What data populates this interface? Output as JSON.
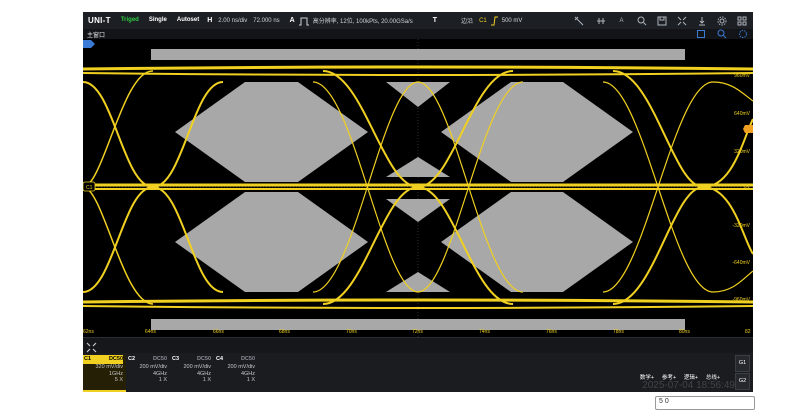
{
  "topbar": {
    "logo": "UNI-T",
    "trig_status": "Triged",
    "single_label": "Single",
    "autoset_label": "Autoset",
    "h_label": "H",
    "timebase": "2.00 ns/div",
    "h_delay": "72.000 ns",
    "a_label": "A",
    "acq_info": "高分辨率, 12位, 100kPts, 20.00GSa/s",
    "t_label": "T",
    "trig_mode": "边沿",
    "trig_src": "C1",
    "trig_level": "500 mV"
  },
  "subbar": {
    "title": "主窗口"
  },
  "scope": {
    "y_labels": [
      "960mV",
      "640mV",
      "320mV",
      "0V",
      "-320mV",
      "-640mV",
      "-960mV"
    ],
    "x_labels": [
      "62ns",
      "64ns",
      "66ns",
      "68ns",
      "70ns",
      "72ns",
      "74ns",
      "76ns",
      "78ns",
      "80ns",
      "82"
    ],
    "trace_color": "#f0d020",
    "mask_color": "#a8a8a8",
    "ch1_marker": "C1"
  },
  "channels": [
    {
      "name": "C1",
      "coupling": "DC50",
      "scale": "320 mV/div",
      "bw": "1GHz",
      "probe": "5 X"
    },
    {
      "name": "C2",
      "coupling": "DC50",
      "scale": "200 mV/div",
      "bw": "4GHz",
      "probe": "1 X"
    },
    {
      "name": "C3",
      "coupling": "DC50",
      "scale": "200 mV/div",
      "bw": "4GHz",
      "probe": "1 X"
    },
    {
      "name": "C4",
      "coupling": "DC50",
      "scale": "200 mV/div",
      "bw": "4GHz",
      "probe": "1 X"
    }
  ],
  "right_buttons": [
    "数学+",
    "参考+",
    "逻辑+",
    "总线+"
  ],
  "g_buttons": [
    "G1",
    "G2"
  ],
  "clock": "2025-07-04 18:56:49",
  "tooltip": "5 0"
}
